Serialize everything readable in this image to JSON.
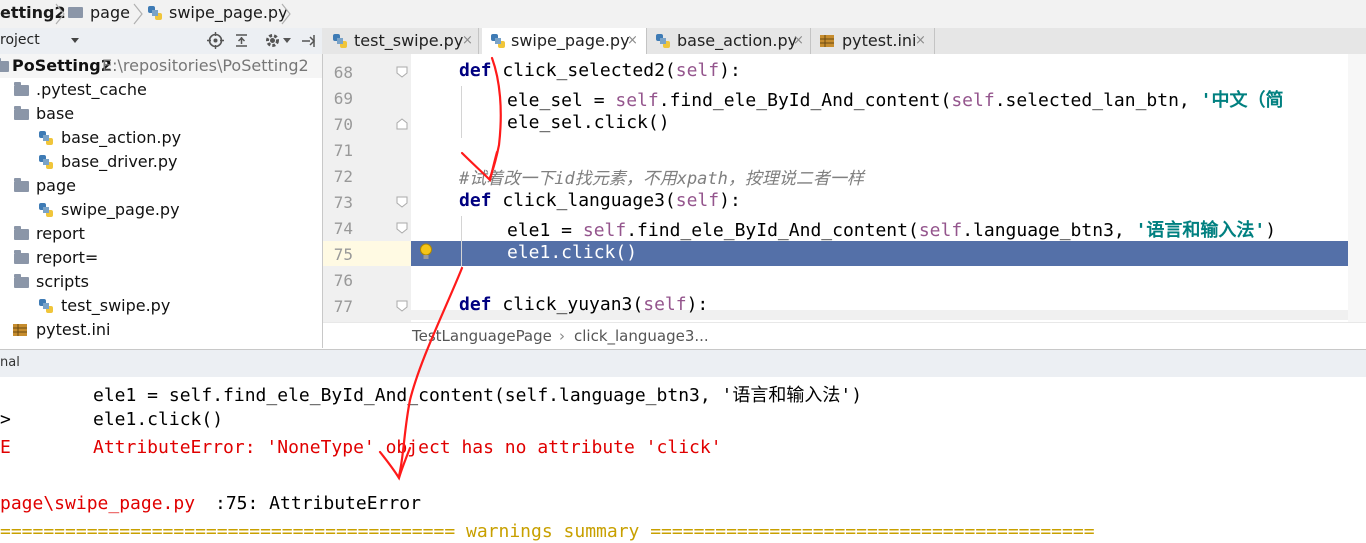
{
  "breadcrumb": {
    "project": "etting2",
    "folder": "page",
    "file": "swipe_page.py"
  },
  "project_panel": {
    "label": "roject",
    "dropdown_icon": "chevron-down-icon",
    "tools": [
      "target-icon",
      "collapse-icon",
      "gear-icon",
      "hide-icon"
    ]
  },
  "tabs": [
    {
      "label": "test_swipe.py",
      "close": "×"
    },
    {
      "label": "swipe_page.py",
      "close": "×"
    },
    {
      "label": "base_action.py",
      "close": "×"
    },
    {
      "label": "pytest.ini",
      "close": "×"
    }
  ],
  "tree": {
    "root": {
      "name": "PoSetting2",
      "path": "E:\\repositories\\PoSetting2"
    },
    "items": [
      {
        "name": ".pytest_cache",
        "kind": "folder"
      },
      {
        "name": "base",
        "kind": "folder"
      },
      {
        "name": "base_action.py",
        "kind": "python"
      },
      {
        "name": "base_driver.py",
        "kind": "python"
      },
      {
        "name": "page",
        "kind": "folder"
      },
      {
        "name": "swipe_page.py",
        "kind": "python"
      },
      {
        "name": "report",
        "kind": "folder"
      },
      {
        "name": "report=",
        "kind": "folder"
      },
      {
        "name": "scripts",
        "kind": "folder"
      },
      {
        "name": "test_swipe.py",
        "kind": "python"
      },
      {
        "name": "pytest.ini",
        "kind": "ini"
      }
    ]
  },
  "editor": {
    "line_numbers": [
      "68",
      "69",
      "70",
      "71",
      "72",
      "73",
      "74",
      "75",
      "76",
      "77"
    ],
    "lines": {
      "l68": {
        "kw": "def",
        "name": " click_selected2(",
        "self": "self",
        "end": "):"
      },
      "l69": {
        "a": "ele_sel = ",
        "self1": "self",
        "b": ".find_ele_ById_And_content(",
        "self2": "self",
        "c": ".selected_lan_btn, ",
        "str": "'中文（简"
      },
      "l70": {
        "a": "ele_sel.click()"
      },
      "l72": {
        "comment": "#试着改一下id找元素，不用xpath，按理说二者一样"
      },
      "l73": {
        "kw": "def",
        "name": " click_language3(",
        "self": "self",
        "end": "):"
      },
      "l74": {
        "a": "ele1 = ",
        "self1": "self",
        "b": ".find_ele_ById_And_content(",
        "self2": "self",
        "c": ".language_btn3, ",
        "str": "'语言和输入法'",
        "end": ")"
      },
      "l75": {
        "a": "ele1.click()"
      },
      "l77": {
        "kw": "def",
        "name": " click_yuyan3(",
        "self": "self",
        "end": "):"
      }
    },
    "crumbs": [
      "TestLanguagePage",
      "click_language3..."
    ],
    "crumb_sep": "›"
  },
  "terminal": {
    "header": "nal",
    "lines": [
      {
        "prefix": "",
        "text": "ele1 = self.find_ele_ById_And_content(self.language_btn3, '语言和输入法')"
      },
      {
        "prefix": ">",
        "text": "ele1.click()"
      },
      {
        "prefix": "E",
        "text": "AttributeError: 'NoneType' object has no attribute 'click'"
      }
    ],
    "location_link": "page\\swipe_page.py",
    "location_rest": ":75: AttributeError",
    "warnings": "========================================== warnings summary ========================================="
  },
  "colors": {
    "keyword": "#000080",
    "self": "#94558d",
    "string": "#008080",
    "comment": "#808080",
    "error": "#e00000",
    "selected_line": "#5470a8",
    "warning": "#c8a000",
    "annotation": "#ff1a1a"
  }
}
